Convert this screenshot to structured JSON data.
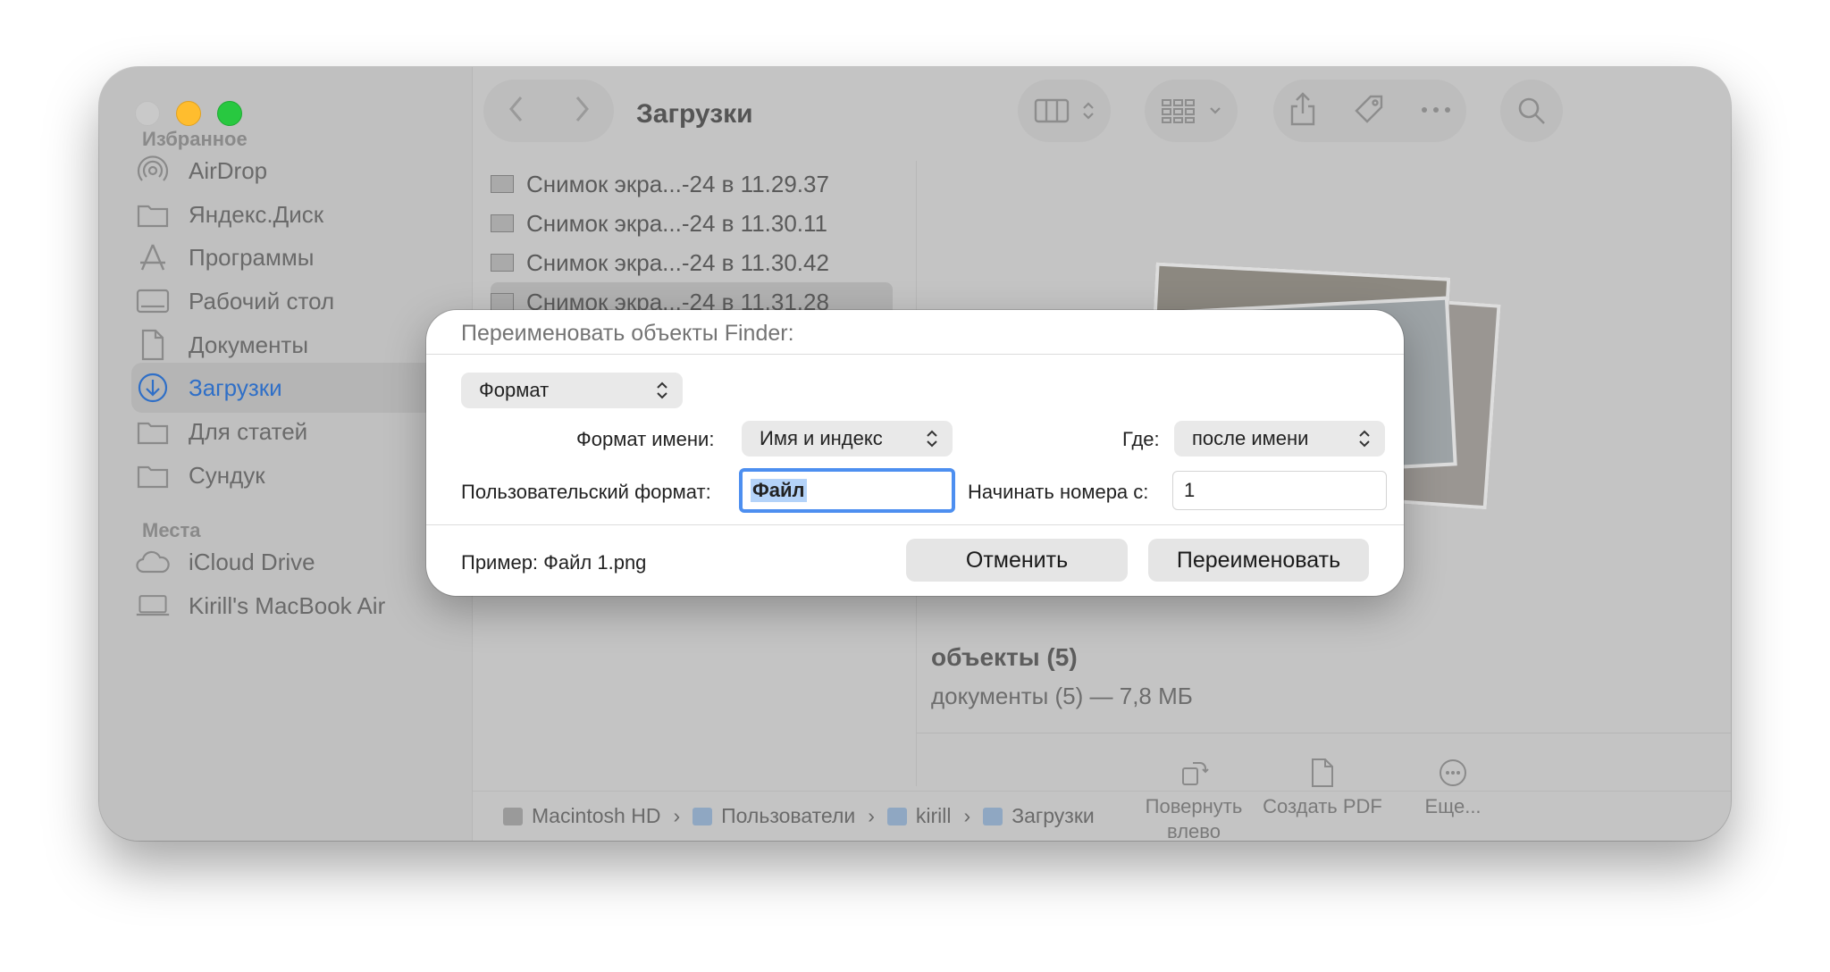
{
  "window": {
    "title": "Загрузки"
  },
  "sidebar": {
    "favorites_header": "Избранное",
    "favorites": [
      {
        "label": "AirDrop",
        "icon": "airdrop-icon"
      },
      {
        "label": "Яндекс.Диск",
        "icon": "folder-icon"
      },
      {
        "label": "Программы",
        "icon": "applications-icon"
      },
      {
        "label": "Рабочий стол",
        "icon": "desktop-icon"
      },
      {
        "label": "Документы",
        "icon": "document-icon"
      },
      {
        "label": "Загрузки",
        "icon": "downloads-icon",
        "active": true
      },
      {
        "label": "Для статей",
        "icon": "folder-icon"
      },
      {
        "label": "Сундук",
        "icon": "folder-icon"
      }
    ],
    "places_header": "Места",
    "places": [
      {
        "label": "iCloud Drive",
        "icon": "cloud-icon"
      },
      {
        "label": "Kirill's MacBook Air",
        "icon": "laptop-icon"
      }
    ]
  },
  "files": [
    {
      "name": "Снимок экра...-24 в 11.29.37"
    },
    {
      "name": "Снимок экра...-24 в 11.30.11"
    },
    {
      "name": "Снимок экра...-24 в 11.30.42"
    },
    {
      "name": "Снимок экра...-24 в 11.31.28",
      "selected": true
    }
  ],
  "preview": {
    "title": "объекты (5)",
    "subtitle": "документы (5) — 7,8 МБ",
    "actions": [
      {
        "label": "Повернуть влево",
        "icon": "rotate-left-icon"
      },
      {
        "label": "Создать PDF",
        "icon": "pdf-icon"
      },
      {
        "label": "Еще...",
        "icon": "more-circle-icon"
      }
    ]
  },
  "pathbar": [
    "Macintosh HD",
    "Пользователи",
    "kirill",
    "Загрузки"
  ],
  "dialog": {
    "title": "Переименовать объекты Finder:",
    "mode_popup": "Формат",
    "name_format_label": "Формат имени:",
    "name_format_value": "Имя и индекс",
    "where_label": "Где:",
    "where_value": "после имени",
    "custom_format_label": "Пользовательский формат:",
    "custom_format_value": "Файл",
    "start_number_label": "Начинать номера с:",
    "start_number_value": "1",
    "example": "Пример: Файл 1.png",
    "cancel_label": "Отменить",
    "rename_label": "Переименовать"
  },
  "colors": {
    "accent": "#4d8ff0",
    "selection": "#b4d3f9",
    "close": "#c9c9c9",
    "minimize": "#ffbd2e",
    "maximize": "#28c840",
    "active_sidebar": "#2f6fc7"
  }
}
